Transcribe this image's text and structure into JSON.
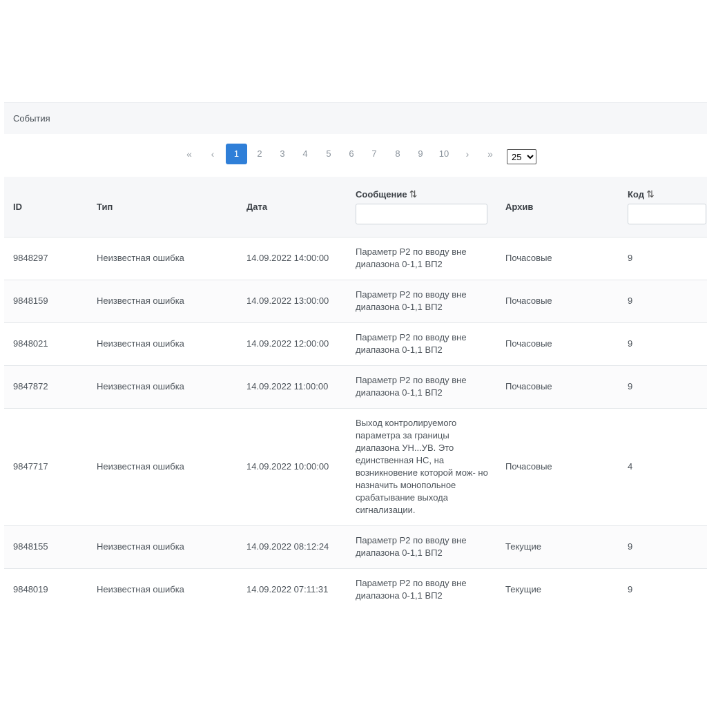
{
  "panel": {
    "title": "События"
  },
  "pagination": {
    "first_icon": "«",
    "prev_icon": "‹",
    "next_icon": "›",
    "last_icon": "»",
    "pages": [
      "1",
      "2",
      "3",
      "4",
      "5",
      "6",
      "7",
      "8",
      "9",
      "10"
    ],
    "active_page": "1",
    "page_size": "25",
    "page_size_options": [
      "25"
    ]
  },
  "table": {
    "columns": {
      "id": "ID",
      "type": "Тип",
      "date": "Дата",
      "message": "Сообщение",
      "archive": "Архив",
      "code": "Код"
    },
    "sort_icon": "⇅",
    "rows": [
      {
        "id": "9848297",
        "type": "Неизвестная ошибка",
        "date": "14.09.2022 14:00:00",
        "message": "Параметр P2 по вводу вне диапазона 0-1,1 ВП2",
        "archive": "Почасовые",
        "code": "9"
      },
      {
        "id": "9848159",
        "type": "Неизвестная ошибка",
        "date": "14.09.2022 13:00:00",
        "message": "Параметр P2 по вводу вне диапазона 0-1,1 ВП2",
        "archive": "Почасовые",
        "code": "9"
      },
      {
        "id": "9848021",
        "type": "Неизвестная ошибка",
        "date": "14.09.2022 12:00:00",
        "message": "Параметр P2 по вводу вне диапазона 0-1,1 ВП2",
        "archive": "Почасовые",
        "code": "9"
      },
      {
        "id": "9847872",
        "type": "Неизвестная ошибка",
        "date": "14.09.2022 11:00:00",
        "message": "Параметр P2 по вводу вне диапазона 0-1,1 ВП2",
        "archive": "Почасовые",
        "code": "9"
      },
      {
        "id": "9847717",
        "type": "Неизвестная ошибка",
        "date": "14.09.2022 10:00:00",
        "message": "Выход контролируемого параметра за границы диапазона УН...УВ. Это единственная НС, на возникновение которой мож- но назначить монопольное срабатывание выхода сигнализации.",
        "archive": "Почасовые",
        "code": "4"
      },
      {
        "id": "9848155",
        "type": "Неизвестная ошибка",
        "date": "14.09.2022 08:12:24",
        "message": "Параметр P2 по вводу вне диапазона 0-1,1 ВП2",
        "archive": "Текущие",
        "code": "9"
      },
      {
        "id": "9848019",
        "type": "Неизвестная ошибка",
        "date": "14.09.2022 07:11:31",
        "message": "Параметр P2 по вводу вне диапазона 0-1,1 ВП2",
        "archive": "Текущие",
        "code": "9"
      }
    ]
  }
}
